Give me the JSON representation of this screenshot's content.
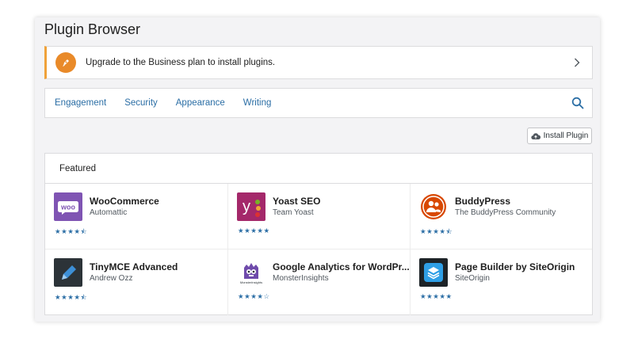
{
  "page": {
    "title": "Plugin Browser"
  },
  "upgrade": {
    "text": "Upgrade to the Business plan to install plugins."
  },
  "nav": {
    "items": [
      "Engagement",
      "Security",
      "Appearance",
      "Writing"
    ]
  },
  "toolbar": {
    "install_label": "Install Plugin"
  },
  "featured": {
    "heading": "Featured",
    "plugins": [
      {
        "name": "WooCommerce",
        "author": "Automattic",
        "rating": 4.5,
        "stars": "★★★★⯪",
        "logo_text": "woo",
        "logo_color": "#7f54b3"
      },
      {
        "name": "Yoast SEO",
        "author": "Team Yoast",
        "rating": 5,
        "stars": "★★★★★",
        "logo_text": "y",
        "logo_color": "#a4286a"
      },
      {
        "name": "BuddyPress",
        "author": "The BuddyPress Community",
        "rating": 4.5,
        "stars": "★★★★⯪",
        "logo_color": "#d84800"
      },
      {
        "name": "TinyMCE Advanced",
        "author": "Andrew Ozz",
        "rating": 4.5,
        "stars": "★★★★⯪",
        "logo_color": "#2c3338"
      },
      {
        "name": "Google Analytics for WordPr...",
        "author": "MonsterInsights",
        "rating": 4,
        "stars": "★★★★☆",
        "logo_text": "MonsterInsights",
        "logo_color": "#6f4bab"
      },
      {
        "name": "Page Builder by SiteOrigin",
        "author": "SiteOrigin",
        "rating": 5,
        "stars": "★★★★★",
        "logo_color": "#1d2327"
      }
    ]
  },
  "colors": {
    "accent": "#2b6ea5",
    "upgrade_border": "#f0a23a",
    "upgrade_icon": "#e98a29"
  }
}
